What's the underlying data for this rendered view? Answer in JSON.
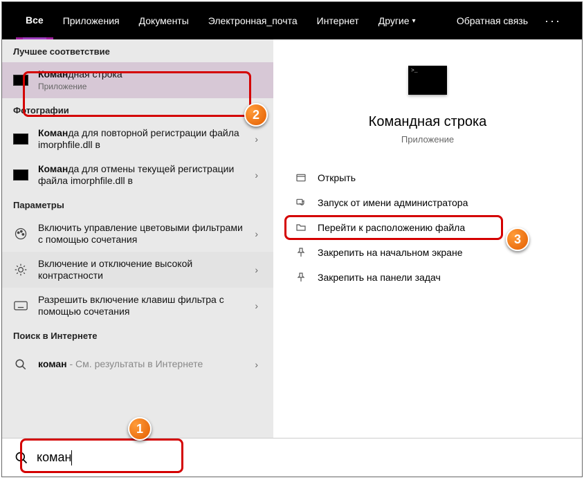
{
  "topbar": {
    "tabs": {
      "all": "Все",
      "apps": "Приложения",
      "docs": "Документы",
      "email": "Электронная_почта",
      "internet": "Интернет",
      "other": "Другие"
    },
    "feedback": "Обратная связь"
  },
  "sections": {
    "best_match": "Лучшее соответствие",
    "photos": "Фотографии",
    "settings": "Параметры",
    "web": "Поиск в Интернете"
  },
  "best": {
    "title_prefix": "Коман",
    "title_rest": "дная строка",
    "subtitle": "Приложение"
  },
  "photos_items": [
    {
      "prefix": "Коман",
      "rest": "да для повторной регистрации файла imorphfile.dll в"
    },
    {
      "prefix": "Коман",
      "rest": "да для отмены текущей регистрации файла imorphfile.dll в"
    }
  ],
  "settings_items": [
    "Включить управление цветовыми фильтрами с помощью сочетания",
    "Включение и отключение высокой контрастности",
    "Разрешить включение клавиш фильтра с помощью сочетания"
  ],
  "web_item": {
    "prefix": "коман",
    "suffix": " - См. результаты в Интернете"
  },
  "detail": {
    "title": "Командная строка",
    "subtitle": "Приложение",
    "actions": {
      "open": "Открыть",
      "run_admin": "Запуск от имени администратора",
      "open_location": "Перейти к расположению файла",
      "pin_start": "Закрепить на начальном экране",
      "pin_taskbar": "Закрепить на панели задач"
    }
  },
  "search": {
    "value": "коман"
  },
  "badges": {
    "b1": "1",
    "b2": "2",
    "b3": "3"
  }
}
